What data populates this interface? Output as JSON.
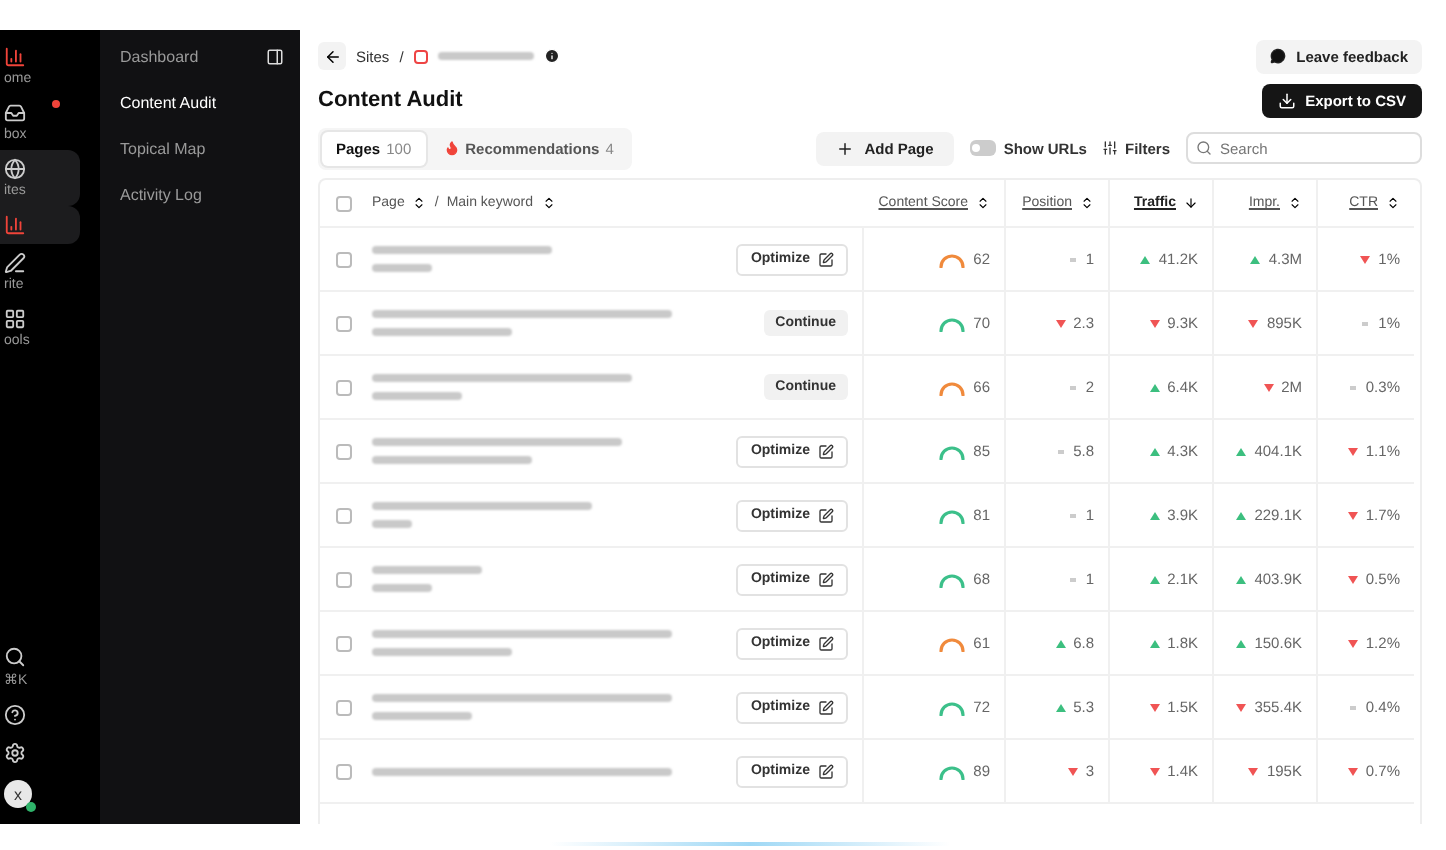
{
  "rail": [
    {
      "kind": "home",
      "label": "ome",
      "selected": false,
      "badge": false
    },
    {
      "kind": "inbox",
      "label": "box",
      "selected": false,
      "badge": true
    },
    {
      "kind": "sites",
      "label": "ites",
      "selected": true,
      "badge": false
    },
    {
      "kind": "audit",
      "selected": true,
      "badge": false
    },
    {
      "kind": "write",
      "label": "rite",
      "selected": false,
      "badge": false
    },
    {
      "kind": "tools",
      "label": "ools",
      "selected": false,
      "badge": false
    }
  ],
  "rail_bottom": [
    {
      "kind": "search",
      "label": "⌘K"
    },
    {
      "kind": "help"
    },
    {
      "kind": "settings"
    },
    {
      "kind": "avatar",
      "label": "x"
    }
  ],
  "nav": {
    "items": [
      {
        "label": "Dashboard",
        "selected": false
      },
      {
        "label": "Content Audit",
        "selected": true
      },
      {
        "label": "Topical Map",
        "selected": false
      },
      {
        "label": "Activity Log",
        "selected": false
      }
    ]
  },
  "header": {
    "breadcrumb": "Sites",
    "separator": "/",
    "title": "Content Audit",
    "feedback": "Leave feedback",
    "export": "Export to CSV"
  },
  "tabs": [
    {
      "kind": "pages",
      "label": "Pages",
      "count": "100",
      "selected": true
    },
    {
      "kind": "recommendations",
      "label": "Recommendations",
      "count": "4",
      "selected": false
    }
  ],
  "toolbar": {
    "add_page": "Add Page",
    "show_urls": {
      "label": "Show URLs",
      "on": false
    },
    "filters": "Filters",
    "search": {
      "placeholder": "Search"
    }
  },
  "table": {
    "all_checked": false,
    "header_separator": "/",
    "columns": [
      {
        "label": "Page",
        "sorted": false
      },
      {
        "label": "Main keyword",
        "sorted": false
      },
      {
        "label": "Content Score",
        "sorted": false
      },
      {
        "label": "Position",
        "sorted": false
      },
      {
        "label": "Traffic",
        "sorted": true
      },
      {
        "label": "Impr.",
        "sorted": false
      },
      {
        "label": "CTR",
        "sorted": false
      }
    ],
    "rows": [
      {
        "checked": false,
        "action": {
          "kind": "optimize",
          "label": "Optimize"
        },
        "score": {
          "value": "62",
          "color": "#f08a3c"
        },
        "position": {
          "value": "1",
          "kind": "flat"
        },
        "traffic": {
          "value": "41.2K",
          "kind": "up"
        },
        "impr": {
          "value": "4.3M",
          "kind": "up"
        },
        "ctr": {
          "value": "1%",
          "kind": "down"
        }
      },
      {
        "checked": false,
        "action": {
          "kind": "continue",
          "label": "Continue"
        },
        "score": {
          "value": "70",
          "color": "#3cc08a"
        },
        "position": {
          "value": "2.3",
          "kind": "down"
        },
        "traffic": {
          "value": "9.3K",
          "kind": "down"
        },
        "impr": {
          "value": "895K",
          "kind": "down"
        },
        "ctr": {
          "value": "1%",
          "kind": "flat"
        }
      },
      {
        "checked": false,
        "action": {
          "kind": "continue",
          "label": "Continue"
        },
        "score": {
          "value": "66",
          "color": "#f08a3c"
        },
        "position": {
          "value": "2",
          "kind": "flat"
        },
        "traffic": {
          "value": "6.4K",
          "kind": "up"
        },
        "impr": {
          "value": "2M",
          "kind": "down"
        },
        "ctr": {
          "value": "0.3%",
          "kind": "flat"
        }
      },
      {
        "checked": false,
        "action": {
          "kind": "optimize",
          "label": "Optimize"
        },
        "score": {
          "value": "85",
          "color": "#3cc08a"
        },
        "position": {
          "value": "5.8",
          "kind": "flat"
        },
        "traffic": {
          "value": "4.3K",
          "kind": "up"
        },
        "impr": {
          "value": "404.1K",
          "kind": "up"
        },
        "ctr": {
          "value": "1.1%",
          "kind": "down"
        }
      },
      {
        "checked": false,
        "action": {
          "kind": "optimize",
          "label": "Optimize"
        },
        "score": {
          "value": "81",
          "color": "#3cc08a"
        },
        "position": {
          "value": "1",
          "kind": "flat"
        },
        "traffic": {
          "value": "3.9K",
          "kind": "up"
        },
        "impr": {
          "value": "229.1K",
          "kind": "up"
        },
        "ctr": {
          "value": "1.7%",
          "kind": "down"
        }
      },
      {
        "checked": false,
        "action": {
          "kind": "optimize",
          "label": "Optimize"
        },
        "score": {
          "value": "68",
          "color": "#3cc08a"
        },
        "position": {
          "value": "1",
          "kind": "flat"
        },
        "traffic": {
          "value": "2.1K",
          "kind": "up"
        },
        "impr": {
          "value": "403.9K",
          "kind": "up"
        },
        "ctr": {
          "value": "0.5%",
          "kind": "down"
        }
      },
      {
        "checked": false,
        "action": {
          "kind": "optimize",
          "label": "Optimize"
        },
        "score": {
          "value": "61",
          "color": "#f08a3c"
        },
        "position": {
          "value": "6.8",
          "kind": "up"
        },
        "traffic": {
          "value": "1.8K",
          "kind": "up"
        },
        "impr": {
          "value": "150.6K",
          "kind": "up"
        },
        "ctr": {
          "value": "1.2%",
          "kind": "down"
        }
      },
      {
        "checked": false,
        "action": {
          "kind": "optimize",
          "label": "Optimize"
        },
        "score": {
          "value": "72",
          "color": "#3cc08a"
        },
        "position": {
          "value": "5.3",
          "kind": "up"
        },
        "traffic": {
          "value": "1.5K",
          "kind": "down"
        },
        "impr": {
          "value": "355.4K",
          "kind": "down"
        },
        "ctr": {
          "value": "0.4%",
          "kind": "flat"
        }
      },
      {
        "checked": false,
        "action": {
          "kind": "optimize",
          "label": "Optimize"
        },
        "score": {
          "value": "89",
          "color": "#3cc08a"
        },
        "position": {
          "value": "3",
          "kind": "down"
        },
        "traffic": {
          "value": "1.4K",
          "kind": "down"
        },
        "impr": {
          "value": "195K",
          "kind": "down"
        },
        "ctr": {
          "value": "0.7%",
          "kind": "down"
        }
      }
    ]
  }
}
